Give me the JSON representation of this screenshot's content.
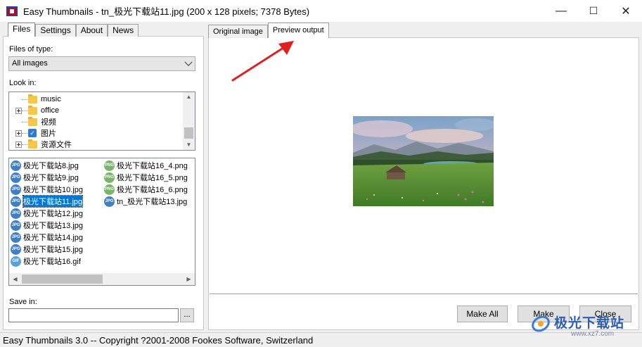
{
  "window": {
    "title": "Easy Thumbnails - tn_极光下载站11.jpg  (200 x 128 pixels;  7378 Bytes)",
    "minimize": "—",
    "maximize": "☐",
    "close": "✕"
  },
  "left_tabs": [
    "Files",
    "Settings",
    "About",
    "News"
  ],
  "files_of_type": {
    "label": "Files of type:",
    "value": "All images"
  },
  "look_in": {
    "label": "Look in:",
    "folders": [
      "music",
      "office",
      "视频",
      "图片",
      "资源文件"
    ]
  },
  "files": {
    "column1": [
      "极光下载站8.jpg",
      "极光下载站9.jpg",
      "极光下载站10.jpg",
      "极光下载站11.jpg",
      "极光下载站12.jpg",
      "极光下载站13.jpg",
      "极光下载站14.jpg",
      "极光下载站15.jpg",
      "极光下载站16.gif"
    ],
    "column2": [
      "极光下载站16_4.png",
      "极光下载站16_5.png",
      "极光下载站16_6.png",
      "tn_极光下载站13.jpg"
    ],
    "selected": "极光下载站11.jpg"
  },
  "save_in": {
    "label": "Save in:",
    "value": "",
    "browse": "..."
  },
  "right_tabs": [
    "Original image",
    "Preview output"
  ],
  "buttons": {
    "make_all": "Make All",
    "make": "Make",
    "close": "Close"
  },
  "status": "Easy Thumbnails 3.0 -- Copyright ?2001-2008 Fookes Software, Switzerland",
  "watermark": {
    "title": "极光下载站",
    "url": "www.xz7.com"
  },
  "colors": {
    "selection": "#0078d7",
    "arrow": "#e02020",
    "watermark": "#2e5db3"
  }
}
